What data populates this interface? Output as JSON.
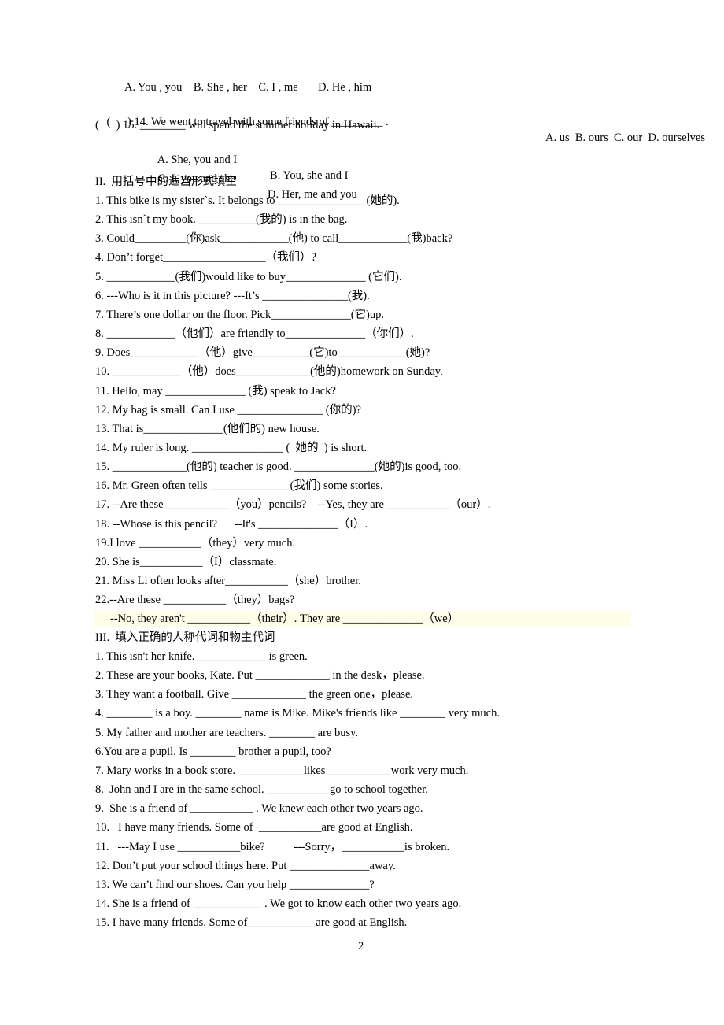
{
  "section1_tail": {
    "q13_options": "A. You , you    B. She , her    C. I , me       D. He , him",
    "q14": "(      ) 14. We went to travel with some friends of _________ .",
    "q14_options": "A. us  B. ours  C. our  D. ourselves",
    "q15": "(      ) 15. ________ will spend the summer holiday in Hawaii.",
    "q15_optA": "A. She, you and I",
    "q15_optB": "B. You, she and I",
    "q15_optC": "C. I, you and she",
    "q15_optD": "D. Her, me and you"
  },
  "section2": {
    "heading": "II.  用括号中的适当形式填空",
    "items": [
      "1. This bike is my sister`s. It belongs to _______________ (她的).",
      "2. This isn`t my book. __________(我的) is in the bag.",
      "3. Could_________(你)ask____________(他) to call____________(我)back?",
      "4. Don’t forget__________________（我们）?",
      "5. ____________(我们)would like to buy______________ (它们).",
      "6. ---Who is it in this picture? ---It’s _______________(我).",
      "7. There’s one dollar on the floor. Pick______________(它)up.",
      "8. ____________（他们）are friendly to______________（你们）.",
      "9. Does____________（他）give__________(它)to____________(她)?",
      "10. ____________（他）does_____________(他的)homework on Sunday.",
      "11. Hello, may ______________ (我) speak to Jack?",
      "12. My bag is small. Can I use _______________ (你的)?",
      "13. That is______________(他们的) new house.",
      "14. My ruler is long. ________________ (  她的  ) is short.",
      "15. _____________(他的) teacher is good. ______________(她的)is good, too.",
      "16. Mr. Green often tells ______________(我们) some stories.",
      "17. --Are these ___________（you）pencils?    --Yes, they are ___________（our）.",
      "18. --Whose is this pencil?      --It's ______________（I）.",
      "19.I love ___________（they）very much.",
      "20. She is___________（I）classmate.",
      "21. Miss Li often looks after___________（she）brother.",
      "22.--Are these ___________（they）bags?"
    ],
    "item22_reply": "--No, they aren't ___________（their）. They are ______________（we）"
  },
  "section3": {
    "heading": "III.  填入正确的人称代词和物主代词",
    "items": [
      "1. This isn't her knife. ____________ is green.",
      "2. These are your books, Kate. Put _____________ in the desk，please.",
      "3. They want a football. Give _____________ the green one，please.",
      "4. ________ is a boy. ________ name is Mike. Mike's friends like ________ very much.",
      "5. My father and mother are teachers. ________ are busy.",
      "6.You are a pupil. Is ________ brother a pupil, too?",
      "7. Mary works in a book store.  ___________likes ___________work very much.",
      "8.  John and I are in the same school. ___________go to school together.",
      "9.  She is a friend of ___________ . We knew each other two years ago.",
      "10.   I have many friends. Some of  ___________are good at English.",
      "11.   ---May I use ___________bike?          ---Sorry，___________is broken.",
      "12. Don’t put your school things here. Put ______________away.",
      "13. We can’t find our shoes. Can you help ______________?",
      "14. She is a friend of ____________ . We got to know each other two years ago.",
      "15. I have many friends. Some of____________are good at English."
    ]
  },
  "page_number": "2",
  "colors": {
    "highlight": "#fdfde8",
    "text": "#000000"
  }
}
